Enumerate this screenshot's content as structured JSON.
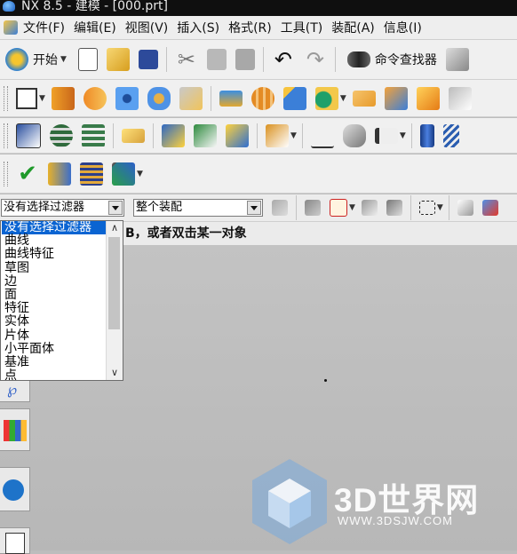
{
  "window": {
    "title": "NX 8.5 - 建模 - [000.prt]"
  },
  "menubar": {
    "items": [
      "文件(F)",
      "编辑(E)",
      "视图(V)",
      "插入(S)",
      "格式(R)",
      "工具(T)",
      "装配(A)",
      "信息(I)"
    ]
  },
  "toolbar": {
    "start_label": "开始",
    "command_finder_label": "命令查找器"
  },
  "filter": {
    "type_filter_value": "没有选择过滤器",
    "scope_value": "整个装配"
  },
  "hint": {
    "text": "B，或者双击某一对象"
  },
  "type_filter_options": [
    "没有选择过滤器",
    "曲线",
    "曲线特征",
    "草图",
    "边",
    "面",
    "特征",
    "实体",
    "片体",
    "小平面体",
    "基准",
    "点"
  ],
  "watermark": {
    "brand": "3D世界网",
    "url": "WWW.3DSJW.COM"
  },
  "colors": {
    "selection": "#0a64d2",
    "title_bar": "#0f0f0f",
    "canvas": "#bdbdbd"
  }
}
